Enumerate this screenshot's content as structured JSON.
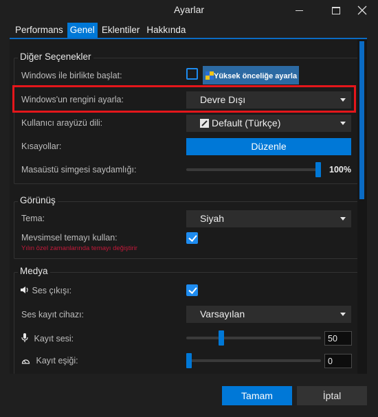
{
  "window": {
    "title": "Ayarlar"
  },
  "tabs": [
    {
      "label": "Performans"
    },
    {
      "label": "Genel"
    },
    {
      "label": "Eklentiler"
    },
    {
      "label": "Hakkında"
    }
  ],
  "other_options": {
    "title": "Diğer Seçenekler",
    "start_with_windows": {
      "label": "Windows ile birlikte başlat:",
      "checked": false,
      "high_priority_button": "Yüksek önceliğe ayarla"
    },
    "windows_color": {
      "label": "Windows'un rengini ayarla:",
      "value": "Devre Dışı"
    },
    "ui_language": {
      "label": "Kullanıcı arayüzü dili:",
      "value": "Default (Türkçe)"
    },
    "shortcuts": {
      "label": "Kısayollar:",
      "button": "Düzenle"
    },
    "desktop_icon_transparency": {
      "label": "Masaüstü simgesi saydamlığı:",
      "value": "100%",
      "fraction": 1.0
    }
  },
  "appearance": {
    "title": "Görünüş",
    "theme": {
      "label": "Tema:",
      "value": "Siyah"
    },
    "seasonal_theme": {
      "label": "Mevsimsel temayı kullan:",
      "checked": true,
      "hint": "Yılın özel zamanlarında temayı değiştirir"
    }
  },
  "media": {
    "title": "Medya",
    "sound_output": {
      "label": "Ses çıkışı:",
      "checked": true
    },
    "recording_device": {
      "label": "Ses kayıt cihazı:",
      "value": "Varsayılan"
    },
    "recording_volume": {
      "label": "Kayıt sesi:",
      "value": "50",
      "fraction": 0.5
    },
    "recording_threshold": {
      "label": "Kayıt eşiği:",
      "value": "0",
      "fraction": 0.0
    }
  },
  "footer": {
    "ok": "Tamam",
    "cancel": "İptal"
  },
  "colors": {
    "accent": "#0078d7",
    "highlight": "#e5161b",
    "hint": "#c4193a"
  }
}
